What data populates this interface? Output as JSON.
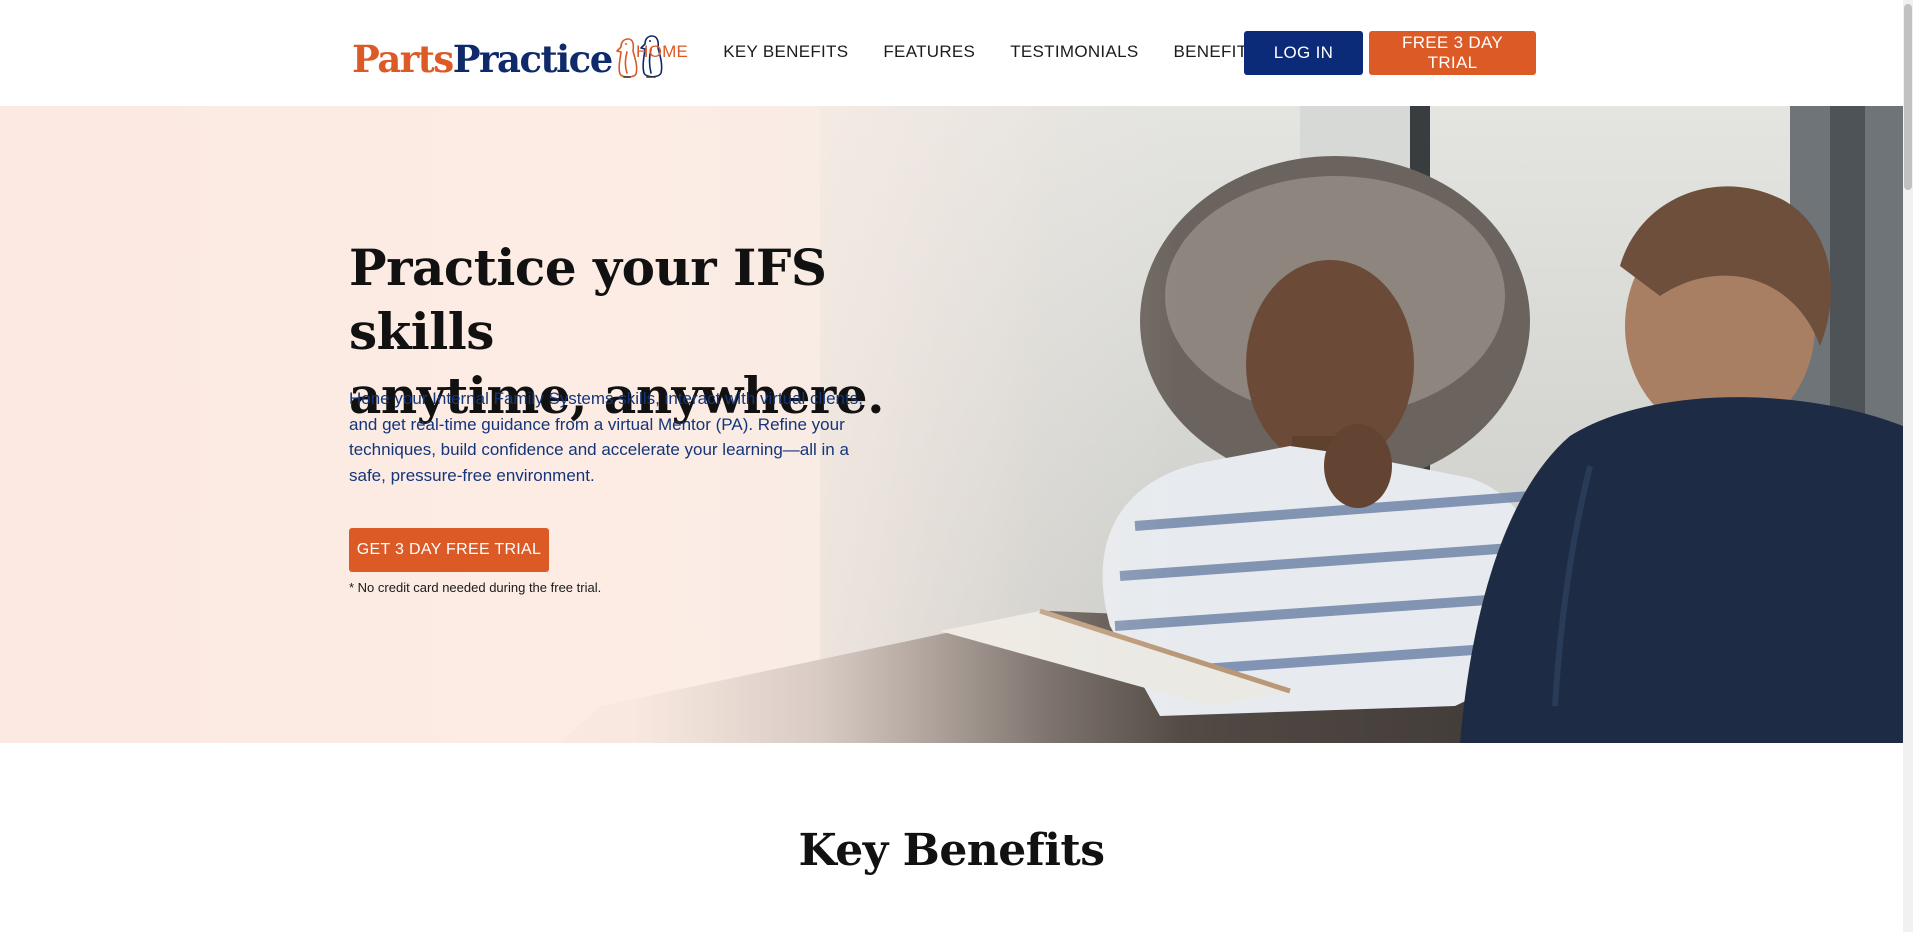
{
  "brand": {
    "name_part1": "Parts",
    "name_part2": "Practice",
    "logo_icon": "two-penguins-icon",
    "colors": {
      "orange": "#dc5a26",
      "navy": "#0b2a78",
      "text_blue": "#14357a"
    }
  },
  "nav": {
    "items": [
      {
        "label": "HOME",
        "active": true
      },
      {
        "label": "KEY BENEFITS",
        "active": false
      },
      {
        "label": "FEATURES",
        "active": false
      },
      {
        "label": "TESTIMONIALS",
        "active": false
      },
      {
        "label": "BENEFITS",
        "active": false
      }
    ],
    "login_label": "LOG IN",
    "trial_label": "FREE 3 DAY TRIAL"
  },
  "hero": {
    "title_line1": "Practice your IFS skills",
    "title_line2": "anytime, anywhere.",
    "body": "Hone your Internal Family Systems skills, interact with virtual clients, and get real-time guidance from a virtual Mentor (PA). Refine your techniques, build confidence and accelerate your learning—all in a safe, pressure-free environment.",
    "cta_label": "GET 3 DAY FREE TRIAL",
    "note": "* No credit card needed during the free trial."
  },
  "key_benefits": {
    "title": "Key Benefits"
  }
}
